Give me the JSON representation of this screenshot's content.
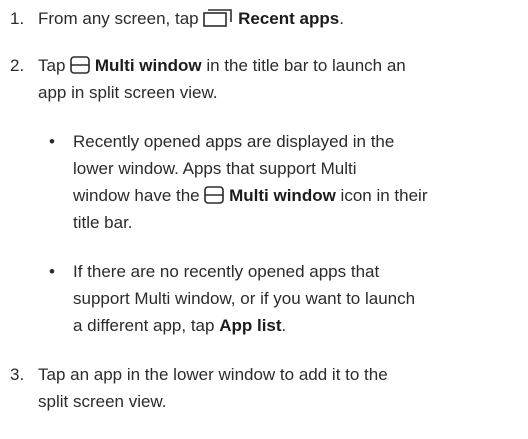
{
  "steps": [
    {
      "number": "1.",
      "prefix": "From any screen, tap",
      "icon": "recent-apps-icon",
      "bold": "Recent apps",
      "suffix": "."
    },
    {
      "number": "2.",
      "line1_prefix": "Tap",
      "icon": "multi-window-icon",
      "bold": "Multi window",
      "line1_suffix": "in the title bar to launch an",
      "line2": "app in split screen view.",
      "bullets": [
        {
          "line1": "Recently opened apps are displayed in the",
          "line2": "lower window. Apps that support Multi",
          "line3_prefix": "window have the",
          "icon": "multi-window-icon",
          "bold": "Multi window",
          "line3_suffix": "icon in their",
          "line4": "title bar."
        },
        {
          "line1": "If there are no recently opened apps that",
          "line2": "support Multi window, or if you want to launch",
          "line3_prefix": "a different app, tap",
          "bold": "App list",
          "line3_suffix": "."
        }
      ]
    },
    {
      "number": "3.",
      "line1": "Tap an app in the lower window to add it to the",
      "line2": "split screen view."
    }
  ]
}
